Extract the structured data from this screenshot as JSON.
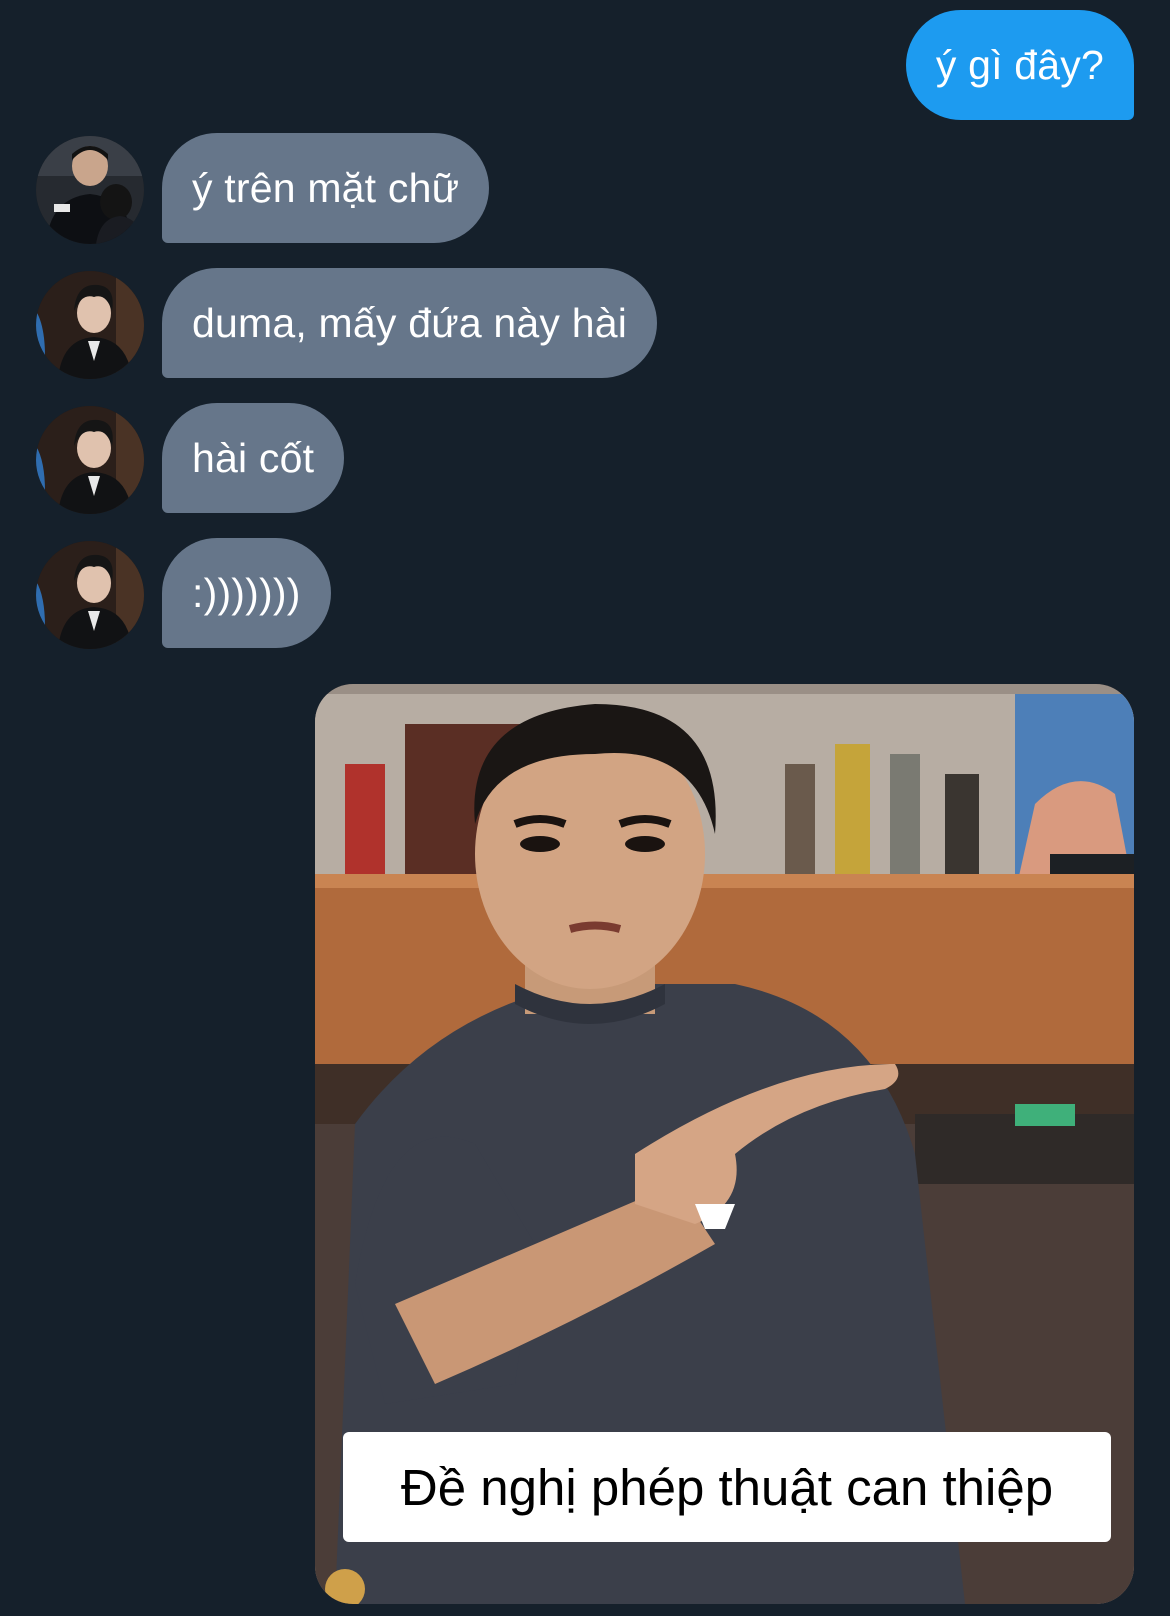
{
  "conversation": {
    "messages": [
      {
        "sender": "me",
        "text": "ý gì đây?"
      },
      {
        "sender": "other-1",
        "text": "ý trên mặt chữ"
      },
      {
        "sender": "other-2",
        "text": "duma, mấy đứa này hài"
      },
      {
        "sender": "other-2",
        "text": "hài cốt"
      },
      {
        "sender": "other-2",
        "text": ":)))))))"
      }
    ],
    "media": {
      "caption": "Đề nghị phép thuật can thiệp"
    }
  },
  "colors": {
    "background": "#15202b",
    "outgoing_bubble": "#1d9bf0",
    "incoming_bubble": "#66768a",
    "text": "#ffffff"
  }
}
